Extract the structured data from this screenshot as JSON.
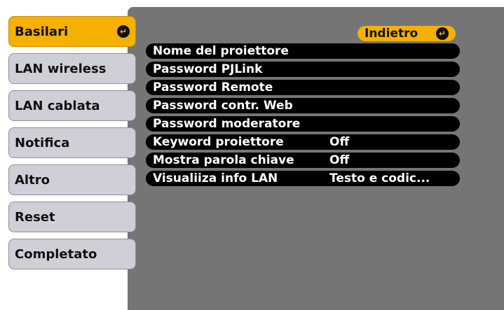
{
  "sidebar": {
    "items": [
      {
        "label": "Basilari",
        "selected": true
      },
      {
        "label": "LAN wireless"
      },
      {
        "label": "LAN cablata"
      },
      {
        "label": "Notifica"
      },
      {
        "label": "Altro"
      },
      {
        "label": "Reset"
      },
      {
        "label": "Completato"
      }
    ],
    "enter_icon": "enter-icon"
  },
  "header": {
    "back_label": "Indietro",
    "back_icon": "enter-icon"
  },
  "menu": {
    "rows": [
      {
        "label": "Nome del proiettore",
        "value": ""
      },
      {
        "label": "Password PJLink",
        "value": ""
      },
      {
        "label": "Password Remote",
        "value": ""
      },
      {
        "label": "Password contr. Web",
        "value": ""
      },
      {
        "label": "Password moderatore",
        "value": ""
      },
      {
        "label": "Keyword proiettore",
        "value": "Off"
      },
      {
        "label": "Mostra parola chiave",
        "value": "Off"
      },
      {
        "label": "Visualiiza info LAN",
        "value": "Testo e codic..."
      }
    ]
  },
  "colors": {
    "accent": "#f5b000",
    "panel": "#757575",
    "nav": "#cfcfd8",
    "row": "#000000"
  }
}
